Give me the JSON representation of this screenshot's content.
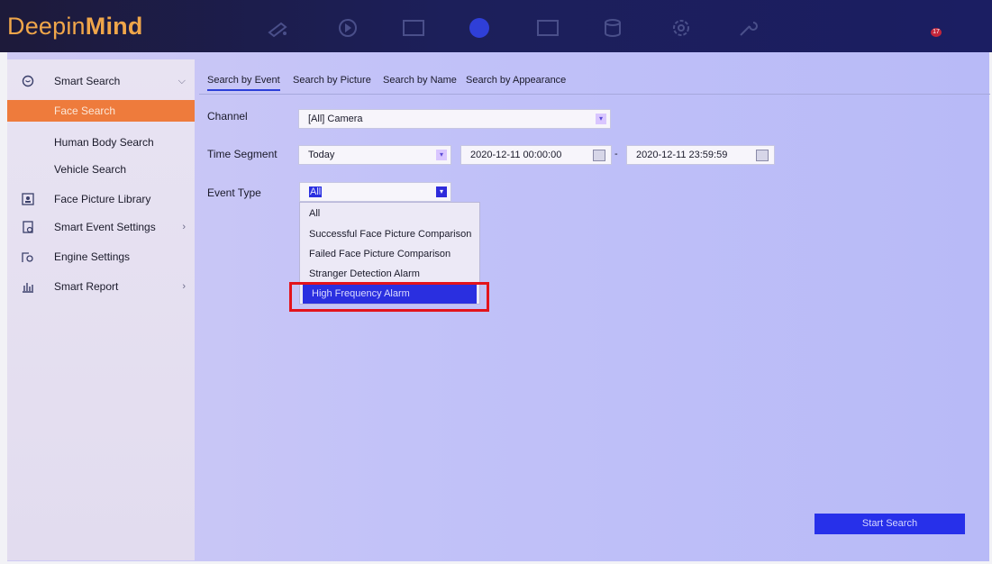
{
  "app": {
    "logo_prefix": "Deepin",
    "logo_bold": "Mind",
    "notification_count": "17"
  },
  "topnav": {
    "icons": [
      "camera-icon",
      "playback-icon",
      "file-icon",
      "smart-search-icon",
      "display-icon",
      "storage-icon",
      "settings-icon",
      "maintenance-icon"
    ],
    "active": "smart-search-icon"
  },
  "sidebar": {
    "items": [
      {
        "label": "Smart Search",
        "icon": "smart-search-icon",
        "chevron": "⌵"
      },
      {
        "label": "Face Search"
      },
      {
        "label": "Human Body Search"
      },
      {
        "label": "Vehicle Search"
      },
      {
        "label": "Face Picture Library",
        "icon": "face-library-icon"
      },
      {
        "label": "Smart Event Settings",
        "icon": "event-settings-icon",
        "chevron": "›"
      },
      {
        "label": "Engine Settings",
        "icon": "engine-icon"
      },
      {
        "label": "Smart Report",
        "icon": "report-icon",
        "chevron": "›"
      }
    ],
    "active_index": 1
  },
  "tabs": {
    "items": [
      "Search by Event",
      "Search by Picture",
      "Search by Name",
      "Search by Appearance"
    ],
    "active_index": 0
  },
  "form": {
    "channel_label": "Channel",
    "channel_value": "[All] Camera",
    "time_segment_label": "Time Segment",
    "time_segment_value": "Today",
    "start_time": "2020-12-11 00:00:00",
    "range_sep": "-",
    "end_time": "2020-12-11 23:59:59",
    "event_type_label": "Event Type",
    "event_type_value": "All"
  },
  "dropdown": {
    "options": [
      "All",
      "Successful Face Picture Comparison",
      "Failed Face Picture Comparison",
      "Stranger Detection Alarm",
      "High Frequency Alarm"
    ],
    "highlighted_index": 4
  },
  "actions": {
    "start_search": "Start Search"
  },
  "colors": {
    "accent_orange": "#ee7b3c",
    "selection_blue": "#2a2fe0",
    "highlight_red": "#e3131b"
  }
}
